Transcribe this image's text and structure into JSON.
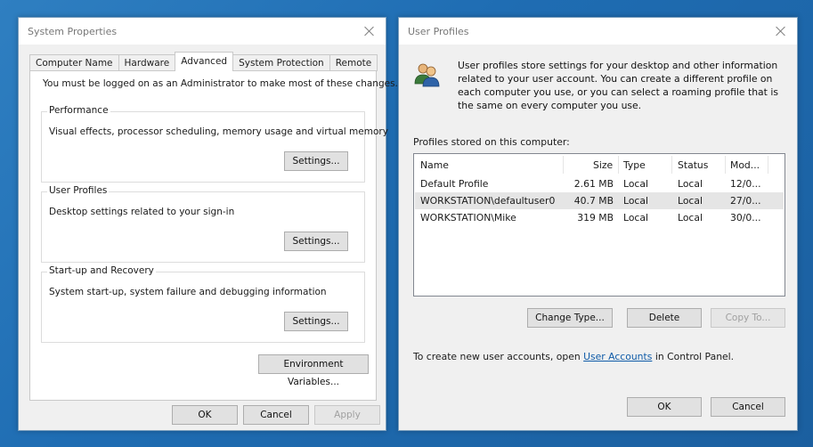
{
  "system_properties": {
    "title": "System Properties",
    "tabs": [
      {
        "label": "Computer Name"
      },
      {
        "label": "Hardware"
      },
      {
        "label": "Advanced"
      },
      {
        "label": "System Protection"
      },
      {
        "label": "Remote"
      }
    ],
    "active_tab": "Advanced",
    "admin_note": "You must be logged on as an Administrator to make most of these changes.",
    "performance": {
      "title": "Performance",
      "description": "Visual effects, processor scheduling, memory usage and virtual memory",
      "button": "Settings..."
    },
    "user_profiles": {
      "title": "User Profiles",
      "description": "Desktop settings related to your sign-in",
      "button": "Settings..."
    },
    "startup_recovery": {
      "title": "Start-up and Recovery",
      "description": "System start-up, system failure and debugging information",
      "button": "Settings..."
    },
    "env_button": "Environment Variables...",
    "ok": "OK",
    "cancel": "Cancel",
    "apply": "Apply"
  },
  "user_profiles_dialog": {
    "title": "User Profiles",
    "description": "User profiles store settings for your desktop and other information related to your user account. You can create a different profile on each computer you use, or you can select a roaming profile that is the same on every computer you use.",
    "stored_label": "Profiles stored on this computer:",
    "columns": {
      "name": "Name",
      "size": "Size",
      "type": "Type",
      "status": "Status",
      "modified": "Mod..."
    },
    "rows": [
      {
        "name": "Default Profile",
        "size": "2.61 MB",
        "type": "Local",
        "status": "Local",
        "modified": "12/0..."
      },
      {
        "name": "WORKSTATION\\defaultuser0",
        "size": "40.7 MB",
        "type": "Local",
        "status": "Local",
        "modified": "27/0..."
      },
      {
        "name": "WORKSTATION\\Mike",
        "size": "319 MB",
        "type": "Local",
        "status": "Local",
        "modified": "30/0..."
      }
    ],
    "change_type": "Change Type...",
    "delete": "Delete",
    "copy_to": "Copy To...",
    "footer_prefix": "To create new user accounts, open ",
    "footer_link": "User Accounts",
    "footer_suffix": " in Control Panel.",
    "ok": "OK",
    "cancel": "Cancel"
  },
  "colors": {
    "desktop": "#1f6db3",
    "window_bg": "#f0f0f0",
    "link": "#0f5ba8",
    "selected_row": "#e5e5e5"
  }
}
